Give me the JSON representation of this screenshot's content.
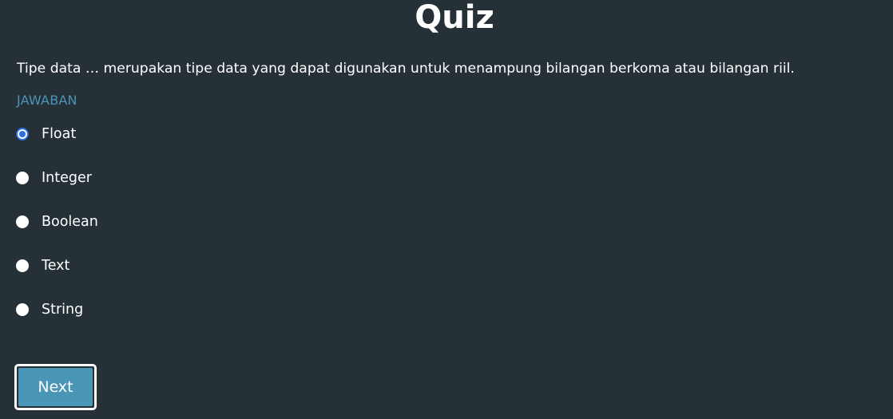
{
  "title": "Quiz",
  "question": "Tipe data … merupakan tipe data yang dapat digunakan untuk menampung bilangan berkoma atau bilangan riil.",
  "answer_label": "JAWABAN",
  "options": [
    {
      "label": "Float",
      "selected": true
    },
    {
      "label": "Integer",
      "selected": false
    },
    {
      "label": "Boolean",
      "selected": false
    },
    {
      "label": "Text",
      "selected": false
    },
    {
      "label": "String",
      "selected": false
    }
  ],
  "next_button": {
    "label": "Next"
  },
  "colors": {
    "background": "#263037",
    "accent": "#4a96b7",
    "radio_selected": "#2a6fe0",
    "text": "#ffffff"
  }
}
